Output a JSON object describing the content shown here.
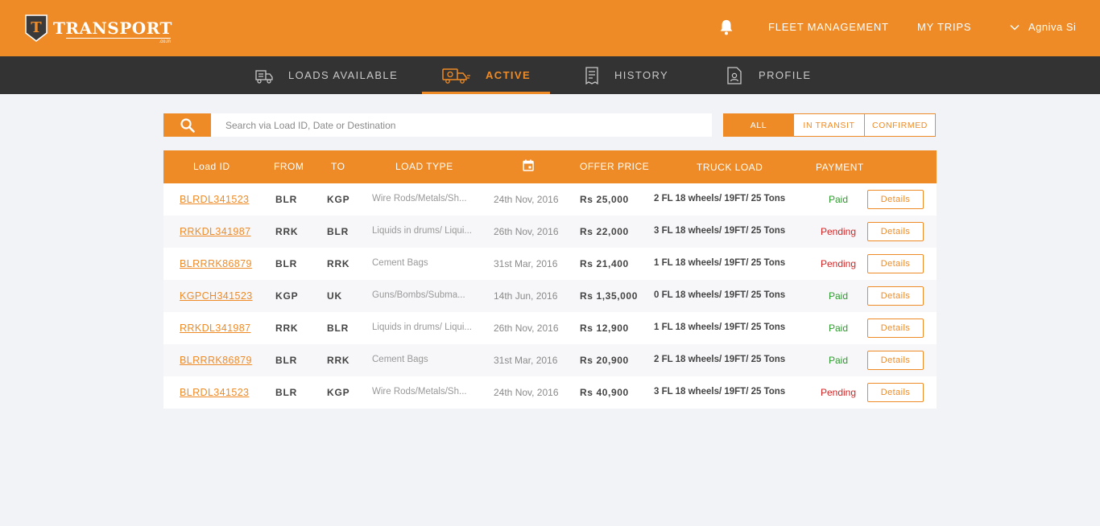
{
  "brand": {
    "name": "TRANSPORT",
    "sub": ".co.in",
    "logo_letter": "T"
  },
  "header": {
    "nav": [
      "FLEET MANAGEMENT",
      "MY TRIPS"
    ],
    "user": "Agniva Si"
  },
  "tabs": [
    {
      "label": "LOADS AVAILABLE",
      "icon": "truck-load-icon"
    },
    {
      "label": "ACTIVE",
      "icon": "moving-truck-icon",
      "active": true
    },
    {
      "label": "HISTORY",
      "icon": "receipt-icon"
    },
    {
      "label": "PROFILE",
      "icon": "profile-document-icon"
    }
  ],
  "search": {
    "placeholder": "Search via Load ID, Date or Destination",
    "value": ""
  },
  "filters": [
    {
      "label": "ALL",
      "selected": true
    },
    {
      "label": "IN TRANSIT",
      "selected": false
    },
    {
      "label": "CONFIRMED",
      "selected": false
    }
  ],
  "table": {
    "headers": {
      "id": "Load ID",
      "from": "FROM",
      "to": "TO",
      "type": "LOAD TYPE",
      "date_icon": "calendar-icon",
      "price": "OFFER PRICE",
      "truck": "TRUCK LOAD",
      "payment": "PAYMENT"
    },
    "rows": [
      {
        "id": "BLRDL341523",
        "from": "BLR",
        "to": "KGP",
        "type": "Wire Rods/Metals/Sh...",
        "date": "24th Nov, 2016",
        "price": "Rs 25,000",
        "truck": "2 FL 18 wheels/ 19FT/ 25 Tons",
        "payment": "Paid",
        "action": "Details"
      },
      {
        "id": "RRKDL341987",
        "from": "RRK",
        "to": "BLR",
        "type": "Liquids in drums/ Liqui...",
        "date": "26th Nov, 2016",
        "price": "Rs 22,000",
        "truck": "3 FL 18 wheels/ 19FT/ 25 Tons",
        "payment": "Pending",
        "action": "Details"
      },
      {
        "id": "BLRRRK86879",
        "from": "BLR",
        "to": "RRK",
        "type": "Cement Bags",
        "date": "31st Mar, 2016",
        "price": "Rs 21,400",
        "truck": "1 FL 18 wheels/ 19FT/ 25 Tons",
        "payment": "Pending",
        "action": "Details"
      },
      {
        "id": "KGPCH341523",
        "from": "KGP",
        "to": "UK",
        "type": "Guns/Bombs/Subma...",
        "date": "14th Jun, 2016",
        "price": "Rs 1,35,000",
        "truck": "0 FL 18 wheels/ 19FT/ 25 Tons",
        "payment": "Paid",
        "action": "Details"
      },
      {
        "id": "RRKDL341987",
        "from": "RRK",
        "to": "BLR",
        "type": "Liquids in drums/ Liqui...",
        "date": "26th Nov, 2016",
        "price": "Rs 12,900",
        "truck": "1 FL 18 wheels/ 19FT/ 25 Tons",
        "payment": "Paid",
        "action": "Details"
      },
      {
        "id": "BLRRRK86879",
        "from": "BLR",
        "to": "RRK",
        "type": "Cement Bags",
        "date": "31st Mar, 2016",
        "price": "Rs 20,900",
        "truck": "2 FL 18 wheels/ 19FT/ 25 Tons",
        "payment": "Paid",
        "action": "Details"
      },
      {
        "id": "BLRDL341523",
        "from": "BLR",
        "to": "KGP",
        "type": "Wire Rods/Metals/Sh...",
        "date": "24th Nov, 2016",
        "price": "Rs 40,900",
        "truck": "3 FL 18 wheels/ 19FT/ 25 Tons",
        "payment": "Pending",
        "action": "Details"
      }
    ]
  },
  "colors": {
    "accent": "#ef8b26",
    "dark_bar": "#333333",
    "paid": "#2d9a2d",
    "pending": "#d32424",
    "background": "#f2f3f7"
  }
}
